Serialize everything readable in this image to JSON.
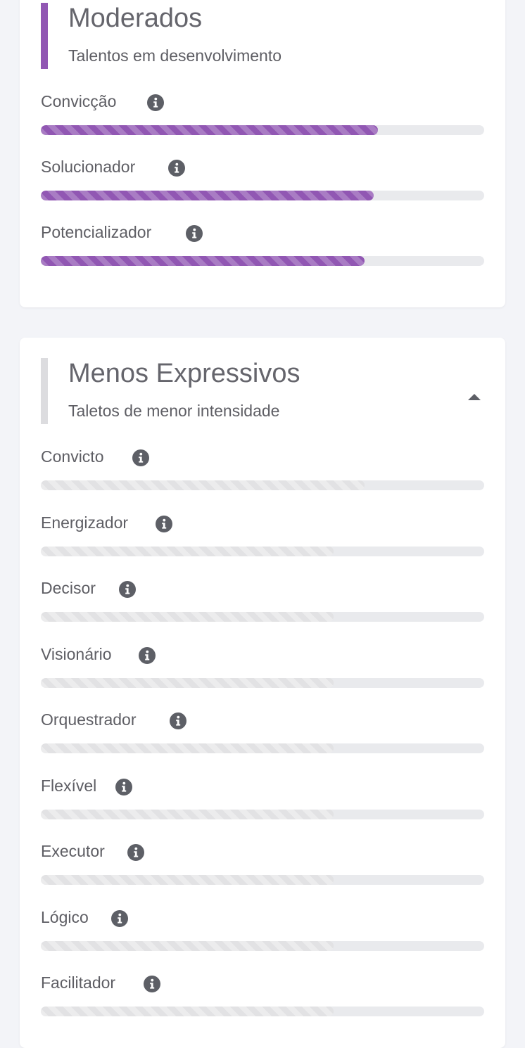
{
  "colors": {
    "page_background": "#f3f4f8",
    "card_background": "#ffffff",
    "accent_purple": "#9157b3",
    "accent_grey": "#dcdcdf",
    "track": "#e9eaed",
    "text": "#5e5e64",
    "icon": "#5d5f66"
  },
  "sections": [
    {
      "id": "moderados",
      "title": "Moderados",
      "subtitle": "Talentos em desenvolvimento",
      "accent": "purple",
      "talents": [
        {
          "name": "Convicção",
          "icon": "info-circle-icon",
          "level_percent": 76
        },
        {
          "name": "Solucionador",
          "icon": "info-circle-icon",
          "level_percent": 75
        },
        {
          "name": "Potencializador",
          "icon": "info-circle-icon",
          "level_percent": 73
        }
      ]
    },
    {
      "id": "menos-expressivos",
      "title": "Menos Expressivos",
      "subtitle": "Taletos de menor intensidade",
      "accent": "grey",
      "collapse_icon": "caret-up-icon",
      "talents": [
        {
          "name": "Convicto",
          "icon": "info-circle-icon",
          "level_percent": 73
        },
        {
          "name": "Energizador",
          "icon": "info-circle-icon",
          "level_percent": 66
        },
        {
          "name": "Decisor",
          "icon": "info-circle-icon",
          "level_percent": 66
        },
        {
          "name": "Visionário",
          "icon": "info-circle-icon",
          "level_percent": 66
        },
        {
          "name": "Orquestrador",
          "icon": "info-circle-icon",
          "level_percent": 66
        },
        {
          "name": "Flexível",
          "icon": "info-circle-icon",
          "level_percent": 66
        },
        {
          "name": "Executor",
          "icon": "info-circle-icon",
          "level_percent": 66
        },
        {
          "name": "Lógico",
          "icon": "info-circle-icon",
          "level_percent": 66
        },
        {
          "name": "Facilitador",
          "icon": "info-circle-icon",
          "level_percent": 66
        }
      ]
    }
  ]
}
